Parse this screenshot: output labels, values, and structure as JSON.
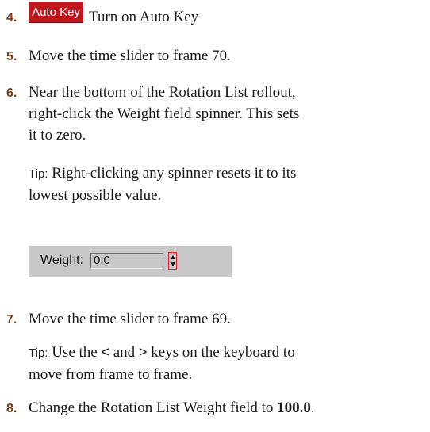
{
  "steps": [
    {
      "number": "4.",
      "button_label": "Auto Key",
      "text": "Turn on Auto Key"
    },
    {
      "number": "5.",
      "text": "Move the time slider to frame 70."
    },
    {
      "number": "6.",
      "lines": [
        "Near the bottom of the Rotation List rollout,",
        "right-click the Weight field spinner. This sets",
        "it to zero."
      ]
    },
    {
      "number": "7.",
      "text": "Move the time slider to frame 69."
    },
    {
      "number": "8.",
      "text_before": "Change the Rotation List Weight field to ",
      "bold_value": "100.0",
      "text_after": "."
    }
  ],
  "tip1": {
    "label": "Tip:",
    "lines": [
      " Right-clicking any spinner resets it to its",
      "lowest possible value."
    ]
  },
  "weight_widget": {
    "label": "Weight:",
    "value": "0.0"
  },
  "tip2": {
    "label": "Tip:",
    "part1": " Use the ",
    "key1": "<",
    "part2": " and ",
    "key2": ">",
    "part3": " keys on the keyboard to",
    "line2": "move from frame to frame."
  }
}
